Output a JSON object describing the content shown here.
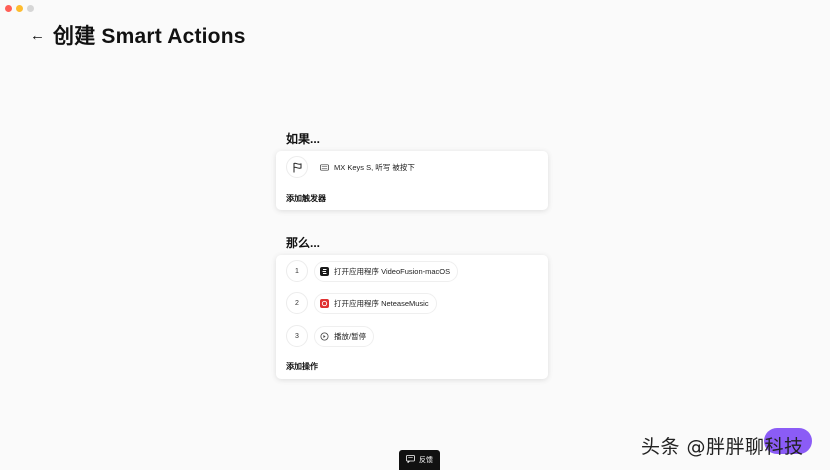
{
  "header": {
    "back_icon": "left-arrow-icon",
    "title": "创建 Smart Actions"
  },
  "trigger_section": {
    "label": "如果...",
    "trigger": {
      "icon": "flag-icon",
      "device_icon": "keyboard-icon",
      "text": "MX Keys S, 听写 被按下"
    },
    "add_label": "添加触发器"
  },
  "action_section": {
    "label": "那么...",
    "actions": [
      {
        "index": "1",
        "icon": "videofusion-app-icon",
        "text": "打开应用程序 VideoFusion-macOS",
        "color": "#1a1a1a"
      },
      {
        "index": "2",
        "icon": "netease-music-app-icon",
        "text": "打开应用程序 NeteaseMusic",
        "color": "#e03131"
      },
      {
        "index": "3",
        "icon": "media-play-pause-icon",
        "text": "播放/暂停",
        "color": "#444444"
      }
    ],
    "add_label": "添加操作"
  },
  "feedback": {
    "icon": "chat-feedback-icon",
    "label": "反馈"
  },
  "watermark": "头条 @胖胖聊科技",
  "colors": {
    "background": "#fafafa",
    "card": "#ffffff",
    "accent_purple": "#8b5cf6",
    "feedback_bg": "#111111"
  }
}
